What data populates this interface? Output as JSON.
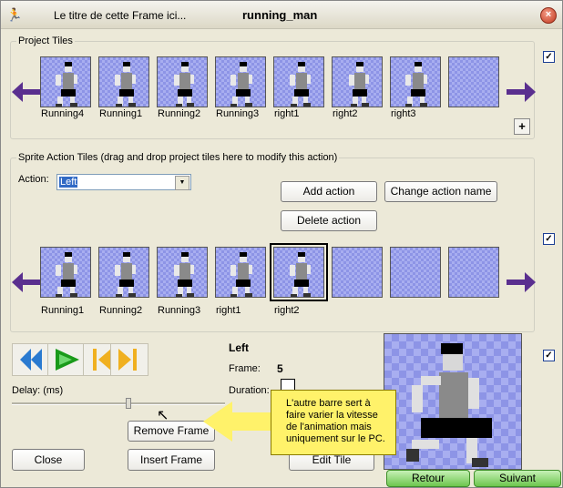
{
  "window": {
    "title_left": "Le titre de cette Frame ici...",
    "title_main": "running_man",
    "close_glyph": "×"
  },
  "project_tiles": {
    "legend": "Project Tiles",
    "items": [
      "Running4",
      "Running1",
      "Running2",
      "Running3",
      "right1",
      "right2",
      "right3",
      ""
    ],
    "plus_label": "+"
  },
  "sprite_action": {
    "legend": "Sprite Action Tiles (drag and drop project tiles here to modify this action)",
    "action_label": "Action:",
    "action_value": "Left",
    "add_action": "Add action",
    "change_action_name": "Change action name",
    "delete_action": "Delete action",
    "items": [
      "Running1",
      "Running2",
      "Running3",
      "right1",
      "right2",
      "",
      "",
      ""
    ]
  },
  "animation": {
    "action_name": "Left",
    "frame_label": "Frame:",
    "frame_value": "5",
    "duration_label": "Duration:",
    "delay_label": "Delay: (ms)",
    "remove_frame": "Remove Frame",
    "insert_frame": "Insert Frame",
    "close": "Close",
    "edit_tile": "Edit Tile"
  },
  "tooltip": {
    "text": "L'autre barre sert à faire varier la vitesse de l'animation mais uniquement sur le PC."
  },
  "nav": {
    "back": "Retour",
    "next": "Suivant"
  },
  "checks": {
    "glyph": "✓"
  },
  "colors": {
    "tile_bg": "#a8aef0",
    "arrow": "#5a2f8f",
    "play": "#1a9a1a",
    "rewind": "#2a7ad0",
    "step": "#f0b020",
    "tooltip": "#fff26a",
    "nav_green": "#6dc64e"
  }
}
